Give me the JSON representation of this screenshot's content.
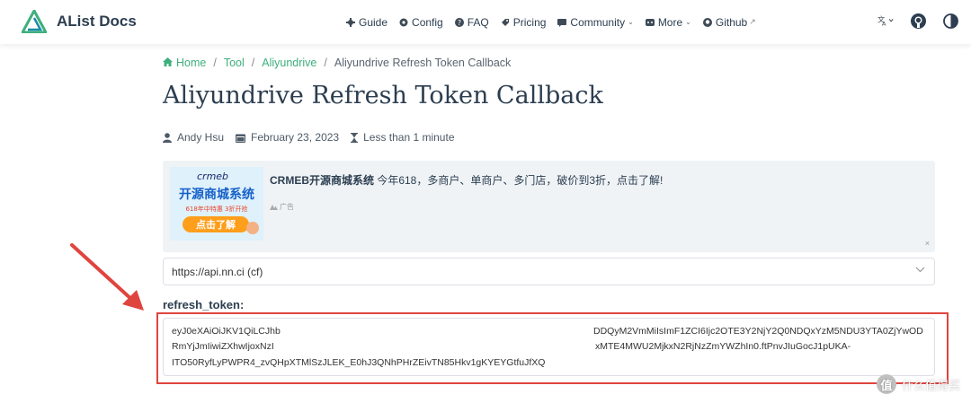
{
  "navbar": {
    "brand": "AList Docs",
    "links": [
      {
        "label": "Guide",
        "icon": "guide-icon",
        "caret": false,
        "external": false
      },
      {
        "label": "Config",
        "icon": "config-icon",
        "caret": false,
        "external": false
      },
      {
        "label": "FAQ",
        "icon": "faq-icon",
        "caret": false,
        "external": false
      },
      {
        "label": "Pricing",
        "icon": "pricing-icon",
        "caret": false,
        "external": false
      },
      {
        "label": "Community",
        "icon": "community-icon",
        "caret": true,
        "external": false
      },
      {
        "label": "More",
        "icon": "more-icon",
        "caret": true,
        "external": false
      },
      {
        "label": "Github",
        "icon": "github-icon",
        "caret": false,
        "external": true
      }
    ],
    "brand_color": "#3eaf7c"
  },
  "breadcrumb": {
    "items": [
      "Home",
      "Tool",
      "Aliyundrive"
    ],
    "current": "Aliyundrive Refresh Token Callback"
  },
  "page": {
    "title": "Aliyundrive Refresh Token Callback",
    "author": "Andy Hsu",
    "date": "February 23, 2023",
    "reading_time": "Less than 1 minute"
  },
  "ad": {
    "brand": "CRMEB开源商城系统",
    "text": " 今年618，多商户、单商户、多门店，破价到3折，点击了解!",
    "tag": "广告",
    "close": "×",
    "image": {
      "logo": "crmeb",
      "headline": "开源商城系统",
      "promo": "618年中特惠 3折开抢",
      "cta": "点击了解"
    }
  },
  "api_select": {
    "value": "https://api.nn.ci (cf)"
  },
  "token": {
    "label": "refresh_token:",
    "line1_left": "eyJ0eXAiOiJKV1QiLCJhb",
    "line1_right": "DDQyM2VmMiIsImF1ZCI6Ijc2OTE3Y2NjY2Q0NDQxYzM5NDU3YTA0ZjYwOD",
    "line2_left": "RmYjJmIiwiZXhwIjoxNzI",
    "line2_right": "xMTE4MWU2MjkxN2RjNzZmYWZhIn0.ftPnvJIuGocJ1pUKA-",
    "line3": "ITO50RyfLyPWPR4_zvQHpXTMlSzJLEK_E0hJ3QNhPHrZEivTN85Hkv1gKYEYGtfuJfXQ"
  },
  "watermark": {
    "logo": "值",
    "text": "什么值得买"
  },
  "colors": {
    "accent": "#3eaf7c",
    "annotation": "#e0443e"
  }
}
